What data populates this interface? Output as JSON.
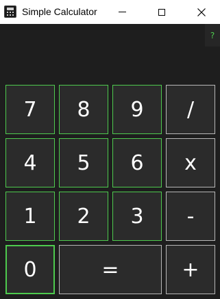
{
  "window": {
    "title": "Simple Calculator",
    "help_label": "?",
    "display_value": ""
  },
  "keys": {
    "k7": "7",
    "k8": "8",
    "k9": "9",
    "divide": "/",
    "k4": "4",
    "k5": "5",
    "k6": "6",
    "multiply": "x",
    "k1": "1",
    "k2": "2",
    "k3": "3",
    "subtract": "-",
    "k0": "0",
    "equals": "=",
    "add": "+"
  },
  "colors": {
    "background": "#1e1e1e",
    "key_fill": "#2b2b2b",
    "digit_border": "#4ecb4e",
    "operator_border": "#b8b8b8",
    "help_text": "#4ecb4e"
  },
  "icons": {
    "app": "calculator-icon",
    "minimize": "minimize-icon",
    "maximize": "maximize-icon",
    "close": "close-icon"
  },
  "focused_key": "0"
}
